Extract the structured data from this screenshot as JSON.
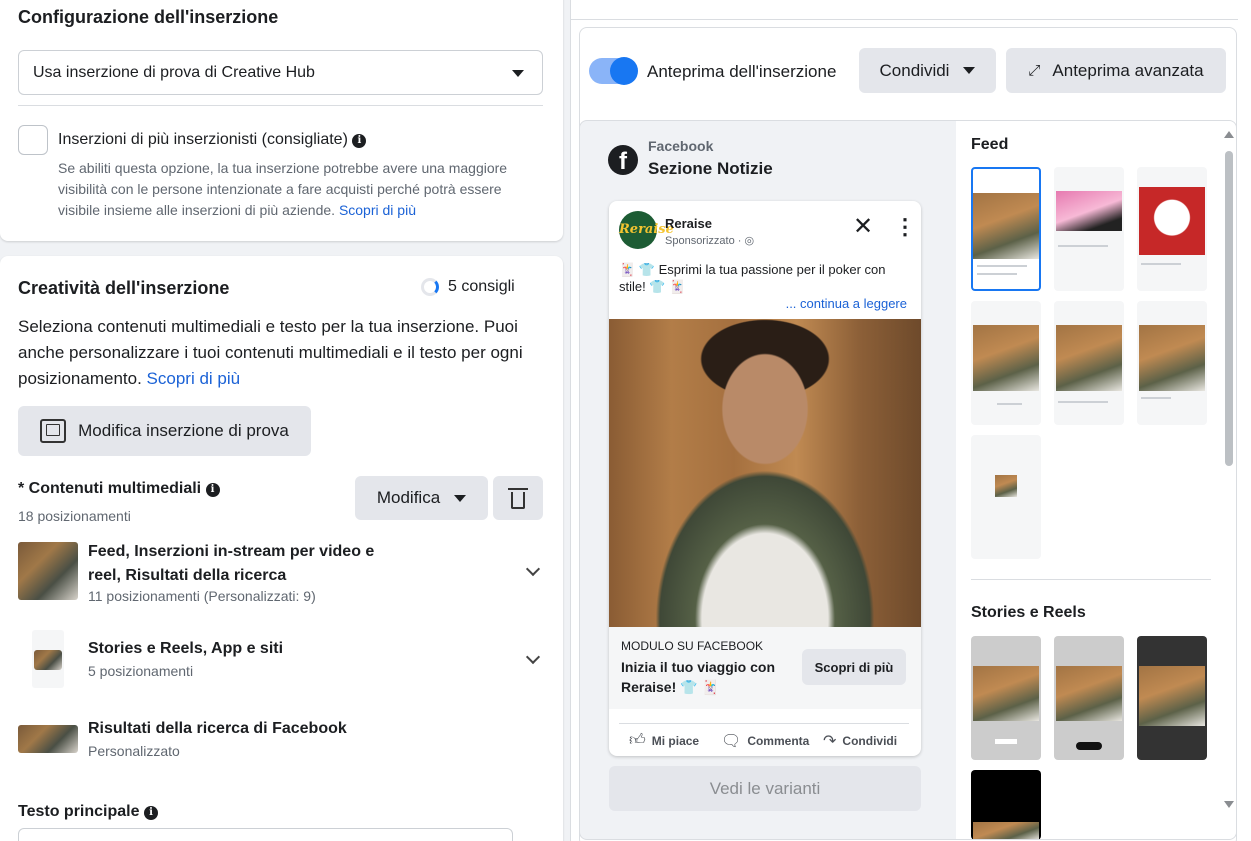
{
  "config": {
    "title": "Configurazione dell'inserzione",
    "select_value": "Usa inserzione di prova di Creative Hub",
    "multi_label": "Inserzioni di più inserzionisti (consigliate)",
    "multi_desc": "Se abiliti questa opzione, la tua inserzione potrebbe avere una maggiore visibilità con le persone intenzionate a fare acquisti perché potrà essere visibile insieme alle inserzioni di più aziende.",
    "learn_more": "Scopri di più"
  },
  "creative": {
    "title": "Creatività dell'inserzione",
    "tips": "5 consigli",
    "desc": "Seleziona contenuti multimediali e testo per la tua inserzione. Puoi anche personalizzare i tuoi contenuti multimediali e il testo per ogni posizionamento.",
    "learn_more": "Scopri di più",
    "edit_test_button": "Modifica inserzione di prova",
    "media_label": "* Contenuti multimediali",
    "media_count": "18 posizionamenti",
    "modify_button": "Modifica",
    "placements": [
      {
        "title_line1": "Feed, Inserzioni in-stream per video e",
        "title_line2": "reel, Risultati della ricerca",
        "sub": "11 posizionamenti (Personalizzati: 9)"
      },
      {
        "title_line1": "Stories e Reels, App e siti",
        "sub": "5 posizionamenti"
      },
      {
        "title_line1": "Risultati della ricerca di Facebook",
        "sub": "Personalizzato"
      }
    ],
    "primary_text_label": "Testo principale"
  },
  "preview": {
    "toggle_label": "Anteprima dell'inserzione",
    "share_button": "Condividi",
    "advanced_button": "Anteprima avanzata",
    "platform": "Facebook",
    "section": "Sezione Notizie",
    "brand": "Reraise",
    "logo_text": "Reraise",
    "sponsored": "Sponsorizzato ·",
    "post_text": "🃏 👕 Esprimi la tua passione per il poker con stile! 👕 🃏",
    "continue": "... continua a leggere",
    "form_label": "MODULO SU FACEBOOK",
    "headline_line1": "Inizia il tuo viaggio con",
    "headline_line2": "Reraise! 👕 🃏",
    "cta": "Scopri di più",
    "like": "Mi piace",
    "comment": "Commenta",
    "share": "Condividi",
    "variants_button": "Vedi le varianti",
    "feed_heading": "Feed",
    "stories_heading": "Stories e Reels"
  }
}
